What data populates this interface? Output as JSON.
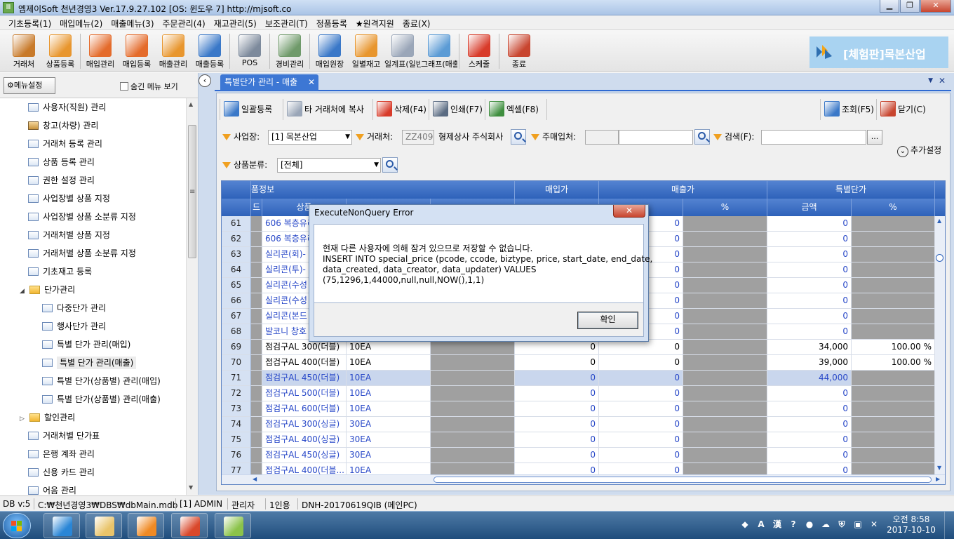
{
  "window": {
    "title": "엠제이Soft 천년경영3   Ver.17.9.27.102   [OS: 윈도우 7]   http://mjsoft.co",
    "app_icon": "app-icon",
    "minimize": "▁",
    "maximize": "❐",
    "close": "✕"
  },
  "menubar": [
    "기초등록(1)",
    "매입메뉴(2)",
    "매출메뉴(3)",
    "주문관리(4)",
    "재고관리(5)",
    "보조관리(T)",
    "정품등록",
    "★원격지원",
    "종료(X)"
  ],
  "toolbar": [
    {
      "label": "거래처",
      "icon": "person-icon",
      "color": "#c87a2a"
    },
    {
      "label": "상품등록",
      "icon": "boxes-icon",
      "color": "#e8962e"
    },
    {
      "label": "매입관리",
      "icon": "purchase-icon",
      "color": "#e46b2b"
    },
    {
      "label": "매입등록",
      "icon": "purchase-add-icon",
      "color": "#e46b2b"
    },
    {
      "label": "매출관리",
      "icon": "sales-icon",
      "color": "#e8962e"
    },
    {
      "label": "매출등록",
      "icon": "sales-add-icon",
      "color": "#3a78c8"
    },
    {
      "label": "POS",
      "icon": "pos-icon",
      "color": "#7d8a9c"
    },
    {
      "label": "경비관리",
      "icon": "calculator-icon",
      "color": "#6f9a6a"
    },
    {
      "label": "매입원장",
      "icon": "ledger-icon",
      "color": "#3a78c8"
    },
    {
      "label": "일별재고",
      "icon": "daily-stock-icon",
      "color": "#e8962e"
    },
    {
      "label": "일계표(일반)",
      "icon": "daily-report-icon",
      "color": "#9aa6b8"
    },
    {
      "label": "그래프(매출)",
      "icon": "chart-icon",
      "color": "#5b9bd5"
    },
    {
      "label": "스케줄",
      "icon": "calendar-icon",
      "color": "#d83b2a"
    },
    {
      "label": "종료",
      "icon": "exit-icon",
      "color": "#c8452f"
    }
  ],
  "brand": {
    "label": "[체험판]목본산업",
    "color": "#a9d3f1"
  },
  "left_panel": {
    "menu_setting": "메뉴설정",
    "hidden_menu": "숨긴 메뉴 보기",
    "items": [
      {
        "label": "사용자(직원) 관리",
        "icon": "user-card-icon",
        "level": 1
      },
      {
        "label": "창고(차량) 관리",
        "icon": "warehouse-icon",
        "level": 1
      },
      {
        "label": "거래처 등록 관리",
        "icon": "client-icon",
        "level": 1
      },
      {
        "label": "상품 등록 관리",
        "icon": "product-icon",
        "level": 1
      },
      {
        "label": "권한 설정 관리",
        "icon": "form-icon",
        "level": 1
      },
      {
        "label": "사업장별 상품 지정",
        "icon": "form-icon",
        "level": 1
      },
      {
        "label": "사업장별 상품 소분류 지정",
        "icon": "form-icon",
        "level": 1
      },
      {
        "label": "거래처별 상품 지정",
        "icon": "form-icon",
        "level": 1
      },
      {
        "label": "거래처별 상품 소분류 지정",
        "icon": "form-icon",
        "level": 1
      },
      {
        "label": "기초재고 등록",
        "icon": "stock-icon",
        "level": 1
      },
      {
        "label": "단가관리",
        "icon": "folder-open-icon",
        "level": 1,
        "expander": "◢"
      },
      {
        "label": "다중단가 관리",
        "icon": "form-icon",
        "level": 2
      },
      {
        "label": "행사단가 관리",
        "icon": "form-icon",
        "level": 2
      },
      {
        "label": "특별 단가 관리(매입)",
        "icon": "form-icon",
        "level": 2
      },
      {
        "label": "특별 단가 관리(매출)",
        "icon": "form-icon",
        "level": 2,
        "selected": true
      },
      {
        "label": "특별 단가(상품별) 관리(매입)",
        "icon": "form-icon",
        "level": 2
      },
      {
        "label": "특별 단가(상품별) 관리(매출)",
        "icon": "form-icon",
        "level": 2
      },
      {
        "label": "할인관리",
        "icon": "folder-icon",
        "level": 1,
        "expander": "▷"
      },
      {
        "label": "거래처별 단가표",
        "icon": "form-icon",
        "level": 1
      },
      {
        "label": "은행 계좌 관리",
        "icon": "form-icon",
        "level": 1
      },
      {
        "label": "신용 카드 관리",
        "icon": "form-icon",
        "level": 1
      },
      {
        "label": "어음 관리",
        "icon": "form-icon",
        "level": 1
      }
    ]
  },
  "tab": {
    "label": "특별단가 관리 - 매출",
    "close": "✕"
  },
  "tab_strip_close": "✕",
  "tab_strip_down": "▼",
  "collapse": "‹",
  "actions": [
    {
      "label": "일괄등록",
      "icon": "bulk-register-icon",
      "color": "#3a78c8"
    },
    {
      "label": "타 거래처에 복사",
      "icon": "copy-icon",
      "color": "#9aa6b8"
    },
    {
      "label": "삭제(F4)",
      "icon": "delete-icon",
      "color": "#d83b2a"
    },
    {
      "label": "인쇄(F7)",
      "icon": "print-icon",
      "color": "#5a6b82"
    },
    {
      "label": "엑셀(F8)",
      "icon": "excel-icon",
      "color": "#3f8f3f"
    },
    {
      "label": "조회(F5)",
      "icon": "search-icon",
      "color": "#3a78c8"
    },
    {
      "label": "닫기(C)",
      "icon": "close-door-icon",
      "color": "#c8452f"
    }
  ],
  "filters": {
    "business_label": "사업장:",
    "business_value": "[1] 목본산업",
    "client_label": "거래처:",
    "client_code": "ZZ409",
    "client_name": "형제상사 주식회사",
    "main_buyer_label": "주매입처:",
    "search_label": "검색(F):",
    "search_dots": "...",
    "category_label": "상품분류:",
    "category_value": "[전체]",
    "more_setting": "추가설정",
    "dropdown": "▼"
  },
  "grid": {
    "header_top": {
      "product": "품정보",
      "buy": "매입가",
      "sell": "매출가",
      "special": "특별단가"
    },
    "header_sub": {
      "code": "드",
      "name": "상품",
      "sell_pct": "%",
      "amount": "금액",
      "pct": "%"
    },
    "rows": [
      {
        "n": "61",
        "name": "606 복층유리",
        "unit": "",
        "buy": "",
        "sell": "0",
        "amt": "0",
        "pct": "",
        "blue": true
      },
      {
        "n": "62",
        "name": "606 복층유리",
        "unit": "",
        "buy": "",
        "sell": "0",
        "amt": "0",
        "pct": "",
        "blue": true
      },
      {
        "n": "63",
        "name": "실리콘(회)-",
        "unit": "",
        "buy": "",
        "sell": "0",
        "amt": "0",
        "pct": "",
        "blue": true
      },
      {
        "n": "64",
        "name": "실리콘(투)-",
        "unit": "",
        "buy": "",
        "sell": "0",
        "amt": "0",
        "pct": "",
        "blue": true
      },
      {
        "n": "65",
        "name": "실리콘(수성",
        "unit": "",
        "buy": "",
        "sell": "0",
        "amt": "0",
        "pct": "",
        "blue": true
      },
      {
        "n": "66",
        "name": "실리콘(수성",
        "unit": "",
        "buy": "",
        "sell": "0",
        "amt": "0",
        "pct": "",
        "blue": true
      },
      {
        "n": "67",
        "name": "실리콘(본드",
        "unit": "",
        "buy": "",
        "sell": "0",
        "amt": "0",
        "pct": "",
        "blue": true
      },
      {
        "n": "68",
        "name": "발코니 창호",
        "unit": "",
        "buy": "",
        "sell": "0",
        "amt": "0",
        "pct": "",
        "blue": true
      },
      {
        "n": "69",
        "name": "점검구AL 300(더블)",
        "unit": "10EA",
        "buy": "0",
        "sell": "0",
        "amt": "34,000",
        "pct": "100.00 %",
        "blue": false
      },
      {
        "n": "70",
        "name": "점검구AL 400(더블)",
        "unit": "10EA",
        "buy": "0",
        "sell": "0",
        "amt": "39,000",
        "pct": "100.00 %",
        "blue": false
      },
      {
        "n": "71",
        "name": "점검구AL 450(더블)",
        "unit": "10EA",
        "buy": "0",
        "sell": "0",
        "amt": "44,000",
        "pct": "",
        "blue": true,
        "selected": true
      },
      {
        "n": "72",
        "name": "점검구AL 500(더블)",
        "unit": "10EA",
        "buy": "0",
        "sell": "0",
        "amt": "0",
        "pct": "",
        "blue": true
      },
      {
        "n": "73",
        "name": "점검구AL 600(더블)",
        "unit": "10EA",
        "buy": "0",
        "sell": "0",
        "amt": "0",
        "pct": "",
        "blue": true
      },
      {
        "n": "74",
        "name": "점검구AL 300(싱글)",
        "unit": "30EA",
        "buy": "0",
        "sell": "0",
        "amt": "0",
        "pct": "",
        "blue": true
      },
      {
        "n": "75",
        "name": "점검구AL 400(싱글)",
        "unit": "30EA",
        "buy": "0",
        "sell": "0",
        "amt": "0",
        "pct": "",
        "blue": true
      },
      {
        "n": "76",
        "name": "점검구AL 450(싱글)",
        "unit": "30EA",
        "buy": "0",
        "sell": "0",
        "amt": "0",
        "pct": "",
        "blue": true
      },
      {
        "n": "77",
        "name": "점검구AL 400(더블...",
        "unit": "10EA",
        "buy": "0",
        "sell": "0",
        "amt": "0",
        "pct": "",
        "blue": true
      }
    ]
  },
  "dialog": {
    "title": "ExecuteNonQuery Error",
    "close": "✕",
    "lines": [
      "현재 다른 사용자에 의해 잠겨 있으므로 저장할 수 없습니다.",
      "INSERT INTO special_price (pcode, ccode, biztype, price, start_date, end_date,",
      "data_created, data_creator, data_updater) VALUES",
      "(75,1296,1,44000,null,null,NOW(),1,1)"
    ],
    "ok": "확인"
  },
  "statusbar": [
    "DB v:5",
    "C:₩천년경영3₩DBS₩dbMain.mdb",
    "[1] ADMIN",
    "관리자",
    "1인용",
    "DNH-20170619QIB (메인PC)"
  ],
  "taskbar": {
    "apps": [
      {
        "name": "ie-icon",
        "color": "#2a86d6"
      },
      {
        "name": "explorer-icon",
        "color": "#e9c46a"
      },
      {
        "name": "media-player-icon",
        "color": "#f08a24"
      },
      {
        "name": "paint-icon",
        "color": "#d9482b"
      },
      {
        "name": "mjsoft-icon",
        "color": "#8bc34a"
      }
    ],
    "tray": [
      "◆",
      "A",
      "漢",
      "?",
      "●",
      "☁",
      "⛨",
      "▣",
      "✕"
    ],
    "time": "오전 8:58",
    "date": "2017-10-10"
  }
}
